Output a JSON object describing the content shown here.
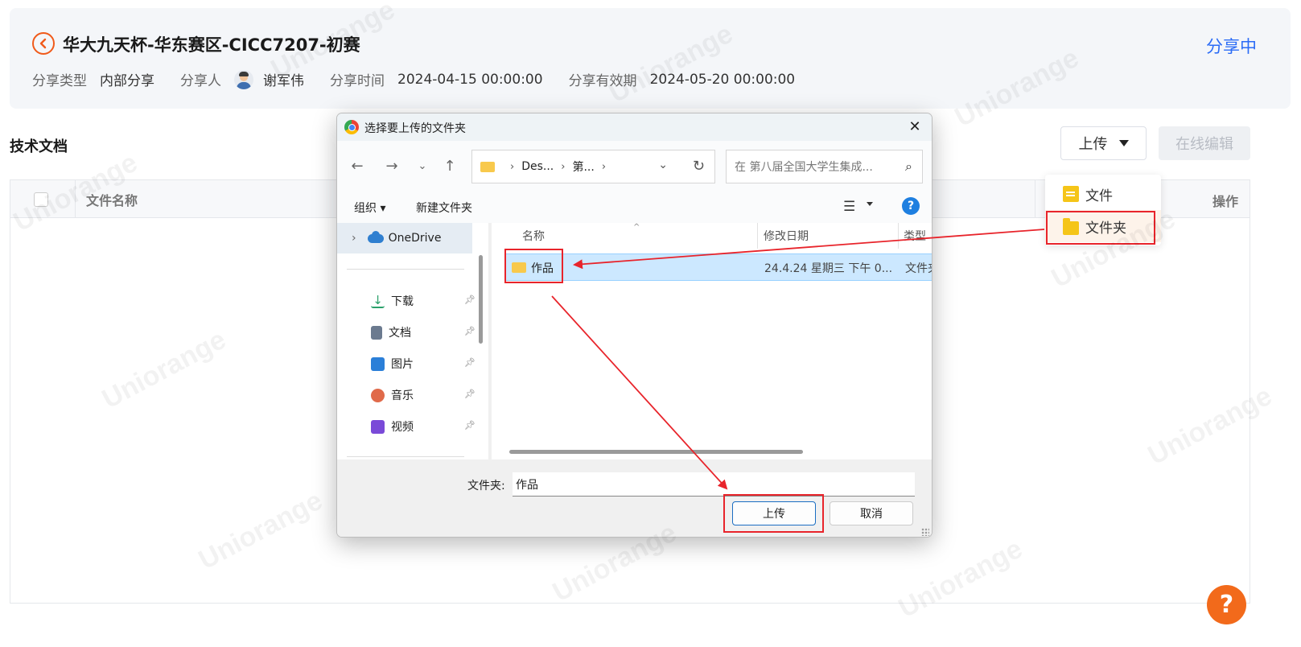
{
  "header": {
    "title": "华大九天杯-华东赛区-CICC7207-初赛",
    "status": "分享中",
    "meta": {
      "type_label": "分享类型",
      "type_value": "内部分享",
      "sharer_label": "分享人",
      "sharer_value": "谢军伟",
      "time_label": "分享时间",
      "time_value": "2024-04-15 00:00:00",
      "valid_label": "分享有效期",
      "valid_value": "2024-05-20 00:00:00"
    }
  },
  "section": {
    "title": "技术文档",
    "upload_label": "上传",
    "edit_label": "在线编辑"
  },
  "dropdown": {
    "file_label": "文件",
    "folder_label": "文件夹"
  },
  "table": {
    "col_name": "文件名称",
    "col_op": "操作"
  },
  "watermark": "Uniorange",
  "dialog": {
    "title": "选择要上传的文件夹",
    "path": [
      "Des...",
      "第..."
    ],
    "search_placeholder": "在 第八届全国大学生集成...",
    "organize_label": "组织",
    "new_folder_label": "新建文件夹",
    "sidebar": {
      "onedrive": "OneDrive",
      "items": [
        {
          "label": "下载",
          "icon": "download-icon",
          "color": "#2aa06a"
        },
        {
          "label": "文档",
          "icon": "document-icon",
          "color": "#6b7a8f"
        },
        {
          "label": "图片",
          "icon": "picture-icon",
          "color": "#2b7fd8"
        },
        {
          "label": "音乐",
          "icon": "music-icon",
          "color": "#e06a4a"
        },
        {
          "label": "视频",
          "icon": "video-icon",
          "color": "#7a4ad8"
        }
      ]
    },
    "columns": {
      "name": "名称",
      "date": "修改日期",
      "type": "类型"
    },
    "file": {
      "name": "作品",
      "date": "24.4.24 星期三 下午 0...",
      "type": "文件夹"
    },
    "folder_label": "文件夹:",
    "folder_value": "作品",
    "upload_button": "上传",
    "cancel_button": "取消"
  },
  "colors": {
    "accent": "#f05a1a",
    "link": "#2b6cf6",
    "annotation": "#e8242b"
  }
}
